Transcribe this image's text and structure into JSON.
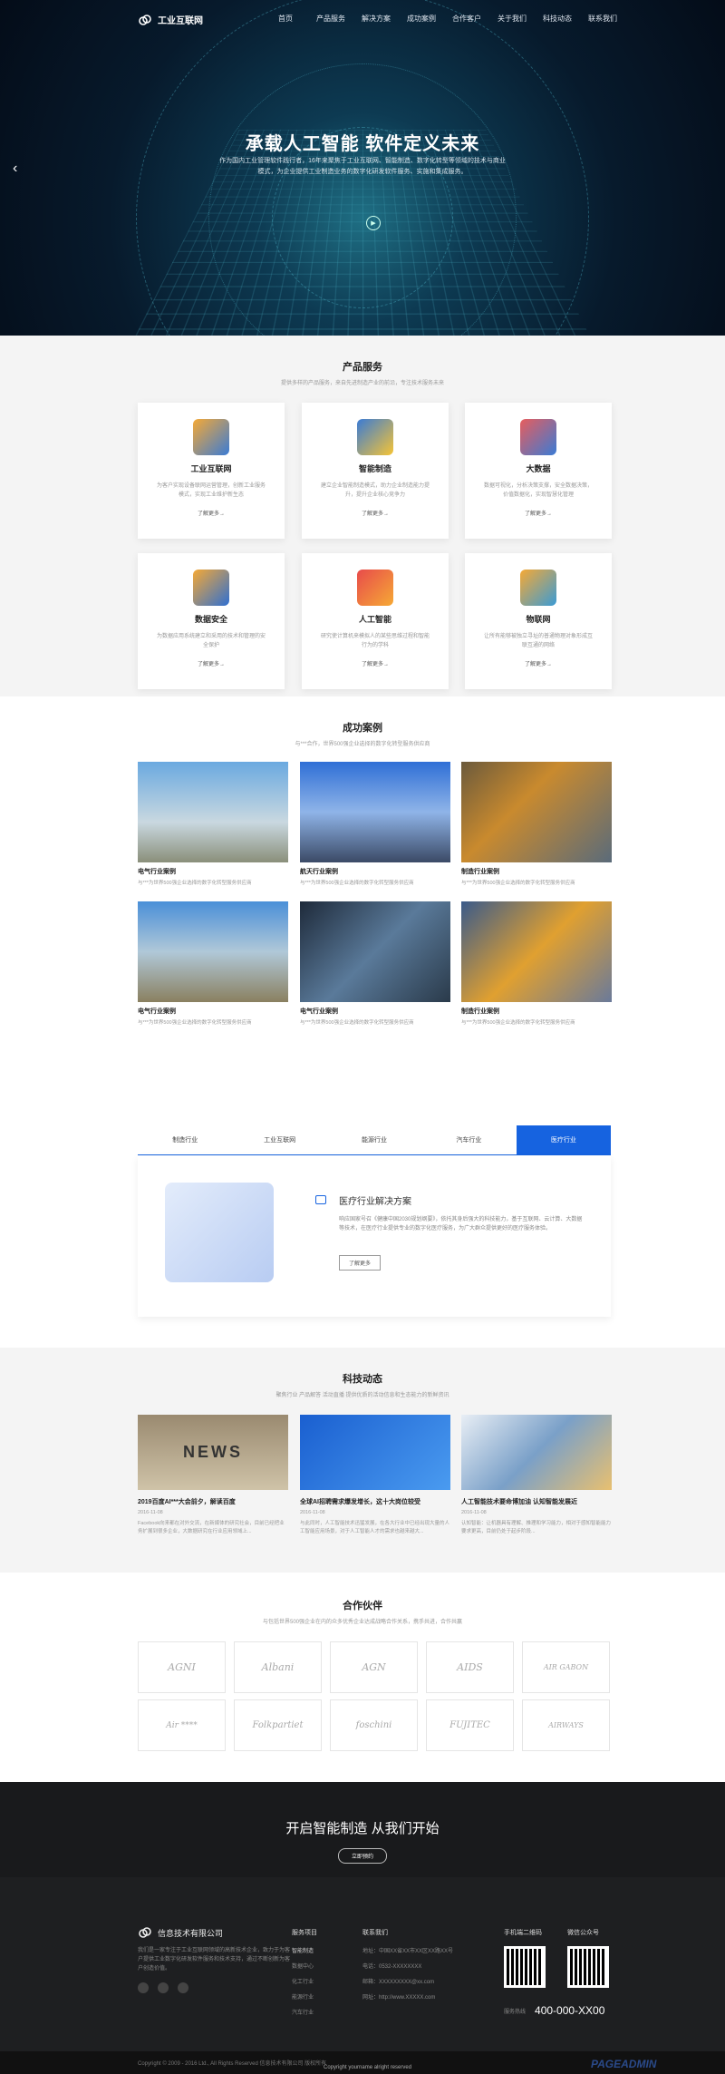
{
  "header": {
    "brand": "工业互联网",
    "nav": [
      "首页",
      "产品服务",
      "解决方案",
      "成功案例",
      "合作客户",
      "关于我们",
      "科技动态",
      "联系我们"
    ]
  },
  "hero": {
    "title": "承载人工智能  软件定义未来",
    "desc": "作为国内工业管理软件践行者，16年来聚焦于工业互联网、智能制造、数字化转型等领域的技术与商业模式，为企业提供工业制造业务的数字化研发软件服务、实施和集成服务。"
  },
  "products": {
    "title": "产品服务",
    "subtitle": "提供多样的产品服务，来自先进制造产业的前沿，专注技术服务未来",
    "more": "了解更多→",
    "items": [
      {
        "name": "工业互联网",
        "desc": "为客户实现设备联网运营管理，创新工业服务模式，实现工业维护新生态"
      },
      {
        "name": "智能制造",
        "desc": "建立企业智能制造模式，助力企业制造能力提升，提升企业核心竞争力"
      },
      {
        "name": "大数据",
        "desc": "数据可视化，分析决策支撑，安全数据决策，价值数据化，实现智慧化管理"
      },
      {
        "name": "数据安全",
        "desc": "为数据应用系统建立和采用的技术和管理的安全保护"
      },
      {
        "name": "人工智能",
        "desc": "研究使计算机来模拟人的某些思维过程和智能行为的学科"
      },
      {
        "name": "物联网",
        "desc": "让所有能够被独立寻址的普通物理对象形成互联互通的网络"
      }
    ]
  },
  "cases": {
    "title": "成功案例",
    "subtitle": "与***合作，世界500强企业选择的数字化转型服务供应商",
    "items": [
      {
        "name": "电气行业案例",
        "desc": "与***为世界500强企业选择的数字化转型服务供应商"
      },
      {
        "name": "航天行业案例",
        "desc": "与***为世界500强企业选择的数字化转型服务供应商"
      },
      {
        "name": "制造行业案例",
        "desc": "与***为世界500强企业选择的数字化转型服务供应商"
      },
      {
        "name": "电气行业案例",
        "desc": "与***为世界500强企业选择的数字化转型服务供应商"
      },
      {
        "name": "电气行业案例",
        "desc": "与***为世界500强企业选择的数字化转型服务供应商"
      },
      {
        "name": "制造行业案例",
        "desc": "与***为世界500强企业选择的数字化转型服务供应商"
      }
    ]
  },
  "solutions": {
    "tabs": [
      "制造行业",
      "工业互联网",
      "能源行业",
      "汽车行业",
      "医疗行业"
    ],
    "panel_title": "医疗行业解决方案",
    "panel_desc": "响应国家号召《健康中国2030规划纲要》，依托其身后强大的科技能力，基于互联网、云计算、大数据等技术，在医疗行业提供专业的数字化医疗服务，为广大群众提供更好的医疗服务体验。",
    "more": "了解更多"
  },
  "news": {
    "title": "科技动态",
    "subtitle": "聚焦行业 产品解答 活动直播 提供优质的活动信息和生态能力的新鲜资讯",
    "items": [
      {
        "title": "2019百度AI***大会前夕，解读百度",
        "date": "2016-11-08",
        "desc": "Facebook向来都在对外交流，在新媒体的研究社会，目前已经把业务扩展到很多企业，大数据研究在行业应用领域上..."
      },
      {
        "title": "全球AI招聘需求爆发增长，这十大岗位较受",
        "date": "2016-11-08",
        "desc": "与此同时，人工智能技术迅猛发展，在各大行业中已经出现大量的人工智能应用场景，对于人工智能人才的需求也越来越大..."
      },
      {
        "title": "人工智能技术要命博加油 认知智能发展近",
        "date": "2016-11-08",
        "desc": "认知智能：让机器具有理解、推理和学习能力，相对于感知智能能力要求更高，目前仍处于起步阶段..."
      }
    ]
  },
  "partners": {
    "title": "合作伙伴",
    "subtitle": "与包括世界500强企业在内的众多优秀企业达成战略合作关系，携手共进，合作共赢",
    "logos": [
      "AGNI",
      "Albani",
      "AGN",
      "AIDS",
      "AIR GABON",
      "Air ****",
      "Folkpartiet",
      "foschini",
      "FUJITEC",
      "AIRWAYS"
    ]
  },
  "cta": {
    "title": "开启智能制造  从我们开始",
    "button": "立即预约"
  },
  "footer": {
    "company": "信息技术有限公司",
    "about": "我们是一家专注于工业互联网领域的高新技术企业，致力于为客户提供工业数字化研发软件服务和技术支持，通过不断创新为客户创造价值。",
    "services_title": "服务项目",
    "services": [
      "智能制造",
      "数据中心",
      "化工行业",
      "能源行业",
      "汽车行业"
    ],
    "contact_title": "联系我们",
    "contact": [
      "地址：中国XX省XX市XX区XX路XX号",
      "电话：0532-XXXXXXXX",
      "邮箱：XXXXXXXXX@xx.com",
      "网址：http://www.XXXXX.com"
    ],
    "qr1": "手机端二维码",
    "qr2": "微信公众号",
    "hotline_label": "服务热线",
    "hotline": "400-000-XX00"
  },
  "copyright": "Copyright © 2009 - 2016 Ltd., All Rights Reserved 信息技术有限公司 版权所有",
  "copyright2": "Copyright yourname alright reserved",
  "watermark": "PAGEADMIN"
}
